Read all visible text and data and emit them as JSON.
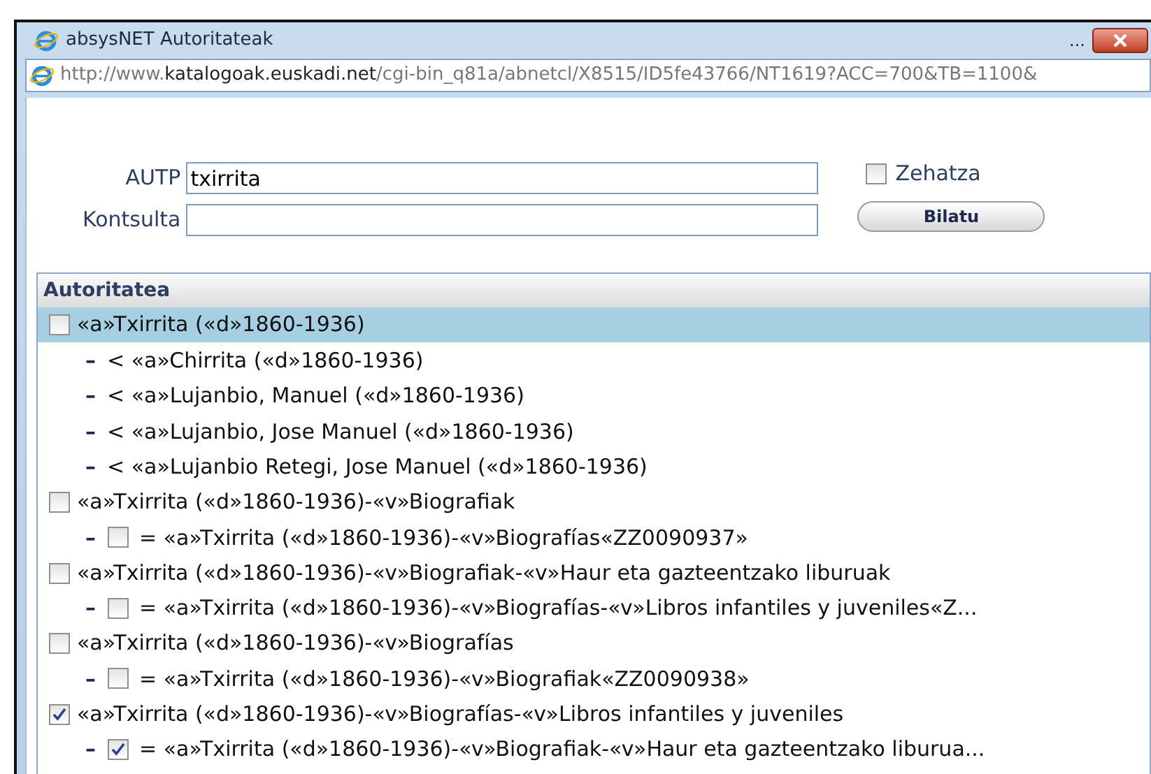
{
  "window": {
    "title": "absysNET Autoritateak",
    "more": "...",
    "url_prefix": "http://www.",
    "url_domain": "katalogoak.euskadi.net",
    "url_rest": "/cgi-bin_q81a/abnetcl/X8515/ID5fe43766/NT1619?ACC=700&TB=1100&"
  },
  "form": {
    "fields": [
      {
        "label": "AUTP",
        "value": "txirrita"
      },
      {
        "label": "Kontsulta"
      }
    ],
    "exact": {
      "label": "Zehatza",
      "checked": false
    },
    "search_button": "Bilatu"
  },
  "list": {
    "heading": "Autoritatea",
    "items": [
      {
        "text": "«a»Txirrita («d»1860-1936)",
        "checked": false,
        "selected": true,
        "children": [
          {
            "kind": "see",
            "marker": "–",
            "sign": "<",
            "text": "«a»Chirrita («d»1860-1936)"
          },
          {
            "kind": "see",
            "marker": "–",
            "sign": "<",
            "text": "«a»Lujanbio, Manuel («d»1860-1936)"
          },
          {
            "kind": "see",
            "marker": "–",
            "sign": "<",
            "text": "«a»Lujanbio, Jose Manuel («d»1860-1936)"
          },
          {
            "kind": "see",
            "marker": "–",
            "sign": "<",
            "text": "«a»Lujanbio Retegi, Jose Manuel («d»1860-1936)"
          }
        ]
      },
      {
        "text": "«a»Txirrita («d»1860-1936)-«v»Biografiak",
        "checked": false,
        "selected": false,
        "children": [
          {
            "kind": "equivalent",
            "marker": "–",
            "sign": "=",
            "checked": false,
            "text": "«a»Txirrita («d»1860-1936)-«v»Biografías«ZZ0090937»"
          }
        ]
      },
      {
        "text": "«a»Txirrita («d»1860-1936)-«v»Biografiak-«v»Haur eta gazteentzako liburuak",
        "checked": false,
        "selected": false,
        "children": [
          {
            "kind": "equivalent",
            "marker": "–",
            "sign": "=",
            "checked": false,
            "text": "«a»Txirrita («d»1860-1936)-«v»Biografías-«v»Libros infantiles y juveniles«Z..."
          }
        ]
      },
      {
        "text": "«a»Txirrita («d»1860-1936)-«v»Biografías",
        "checked": false,
        "selected": false,
        "children": [
          {
            "kind": "equivalent",
            "marker": "–",
            "sign": "=",
            "checked": false,
            "text": "«a»Txirrita («d»1860-1936)-«v»Biografiak«ZZ0090938»"
          }
        ]
      },
      {
        "text": "«a»Txirrita («d»1860-1936)-«v»Biografías-«v»Libros infantiles y juveniles",
        "checked": true,
        "selected": false,
        "children": [
          {
            "kind": "equivalent",
            "marker": "–",
            "sign": "=",
            "checked": true,
            "text": "«a»Txirrita («d»1860-1936)-«v»Biografiak-«v»Haur eta gazteentzako liburua..."
          }
        ]
      }
    ]
  }
}
